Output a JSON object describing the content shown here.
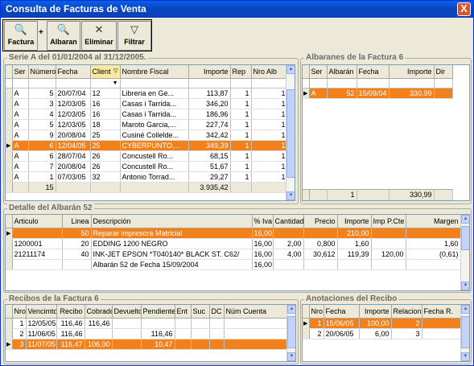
{
  "window": {
    "title": "Consulta de Facturas de Venta",
    "close": "X"
  },
  "toolbar": {
    "factura": "Factura",
    "plus": "+",
    "albaran": "Albaran",
    "eliminar": "Eliminar",
    "filtrar": "Filtrar"
  },
  "series": {
    "label": "Serie A del 01/01/2004 al 31/12/2005.",
    "headers": [
      "Ser",
      "Número",
      "Fecha",
      "Client",
      "Nombre Fiscal",
      "Importe",
      "Rep",
      "Nro Alb"
    ],
    "rows": [
      [
        "A",
        "5",
        "20/07/04",
        "12",
        "Libreria en Ge...",
        "113,87",
        "1",
        "1"
      ],
      [
        "A",
        "3",
        "12/03/05",
        "16",
        "Casas i Tarrida...",
        "346,20",
        "1",
        "1"
      ],
      [
        "A",
        "4",
        "12/03/05",
        "16",
        "Casas i Tarrida...",
        "186,96",
        "1",
        "1"
      ],
      [
        "A",
        "5",
        "12/03/05",
        "18",
        "Maroto Garcia,...",
        "227,74",
        "1",
        "1"
      ],
      [
        "A",
        "9",
        "20/08/04",
        "25",
        "Cusiné Collelde...",
        "342,42",
        "1",
        "1"
      ],
      [
        "A",
        "6",
        "12/04/05",
        "25",
        "CYBERPUNTO,...",
        "349,39",
        "1",
        "1"
      ],
      [
        "A",
        "6",
        "28/07/04",
        "26",
        "Concustell Ro...",
        "68,15",
        "1",
        "1"
      ],
      [
        "A",
        "7",
        "20/08/04",
        "26",
        "Concustell Ro...",
        "51,67",
        "1",
        "1"
      ],
      [
        "A",
        "1",
        "07/03/05",
        "32",
        "Antonio Torrad...",
        "29,27",
        "1",
        "1"
      ]
    ],
    "selected": 5,
    "total_count": "15",
    "total_importe": "3.935,42"
  },
  "albaranes": {
    "label": "Albaranes de la Factura 6",
    "headers": [
      "Ser",
      "Albarán",
      "Fecha",
      "Importe",
      "Dir"
    ],
    "rows": [
      [
        "A",
        "52",
        "15/09/04",
        "330,99",
        ""
      ]
    ],
    "total_count": "1",
    "total_importe": "330,99"
  },
  "detalle": {
    "label": "Detalle del Albarán 52",
    "headers": [
      "Articulo",
      "Linea",
      "Descripción",
      "% Iva",
      "Cantidad",
      "Precio",
      "Importe",
      "Imp P.Cte",
      "Margen"
    ],
    "rows": [
      [
        "",
        "50",
        "Reparar impresora Matricial",
        "16,00",
        "",
        "",
        "210,00",
        "",
        ""
      ],
      [
        "1200001",
        "20",
        "EDDING 1200 NEGRO",
        "16,00",
        "2,00",
        "0,800",
        "1,60",
        "",
        "1,60"
      ],
      [
        "21211174",
        "40",
        "INK-JET EPSON *T040140* BLACK ST. C62/",
        "16,00",
        "4,00",
        "30,612",
        "119,39",
        "120,00",
        "(0,61)"
      ],
      [
        "",
        "",
        "Albarán  52 de Fecha  15/09/2004",
        "16,00",
        "",
        "",
        "",
        "",
        ""
      ]
    ]
  },
  "recibos": {
    "label": "Recibos de la Factura  6",
    "headers": [
      "Nro",
      "Vencimto",
      "Recibo",
      "Cobrado",
      "Devuelto",
      "Pendiente",
      "Ent",
      "Suc",
      "DC",
      "Núm Cuenta"
    ],
    "rows": [
      [
        "1",
        "12/05/05",
        "116,46",
        "116,46",
        "",
        "",
        "",
        "",
        "",
        ""
      ],
      [
        "2",
        "11/06/05",
        "116,46",
        "",
        "",
        "116,46",
        "",
        "",
        "",
        ""
      ],
      [
        "3",
        "11/07/05",
        "116,47",
        "106,00",
        "",
        "10,47",
        "",
        "",
        "",
        ""
      ]
    ]
  },
  "anotaciones": {
    "label": "Anotaciones del Recibo",
    "headers": [
      "Nro",
      "Fecha",
      "Importe",
      "Relacion",
      "Fecha R."
    ],
    "rows": [
      [
        "1",
        "15/06/05",
        "100,00",
        "2",
        ""
      ],
      [
        "2",
        "20/06/05",
        "6,00",
        "3",
        ""
      ]
    ]
  },
  "colors": {
    "selection": "#f2811b",
    "titlebar": "#0847c6"
  }
}
